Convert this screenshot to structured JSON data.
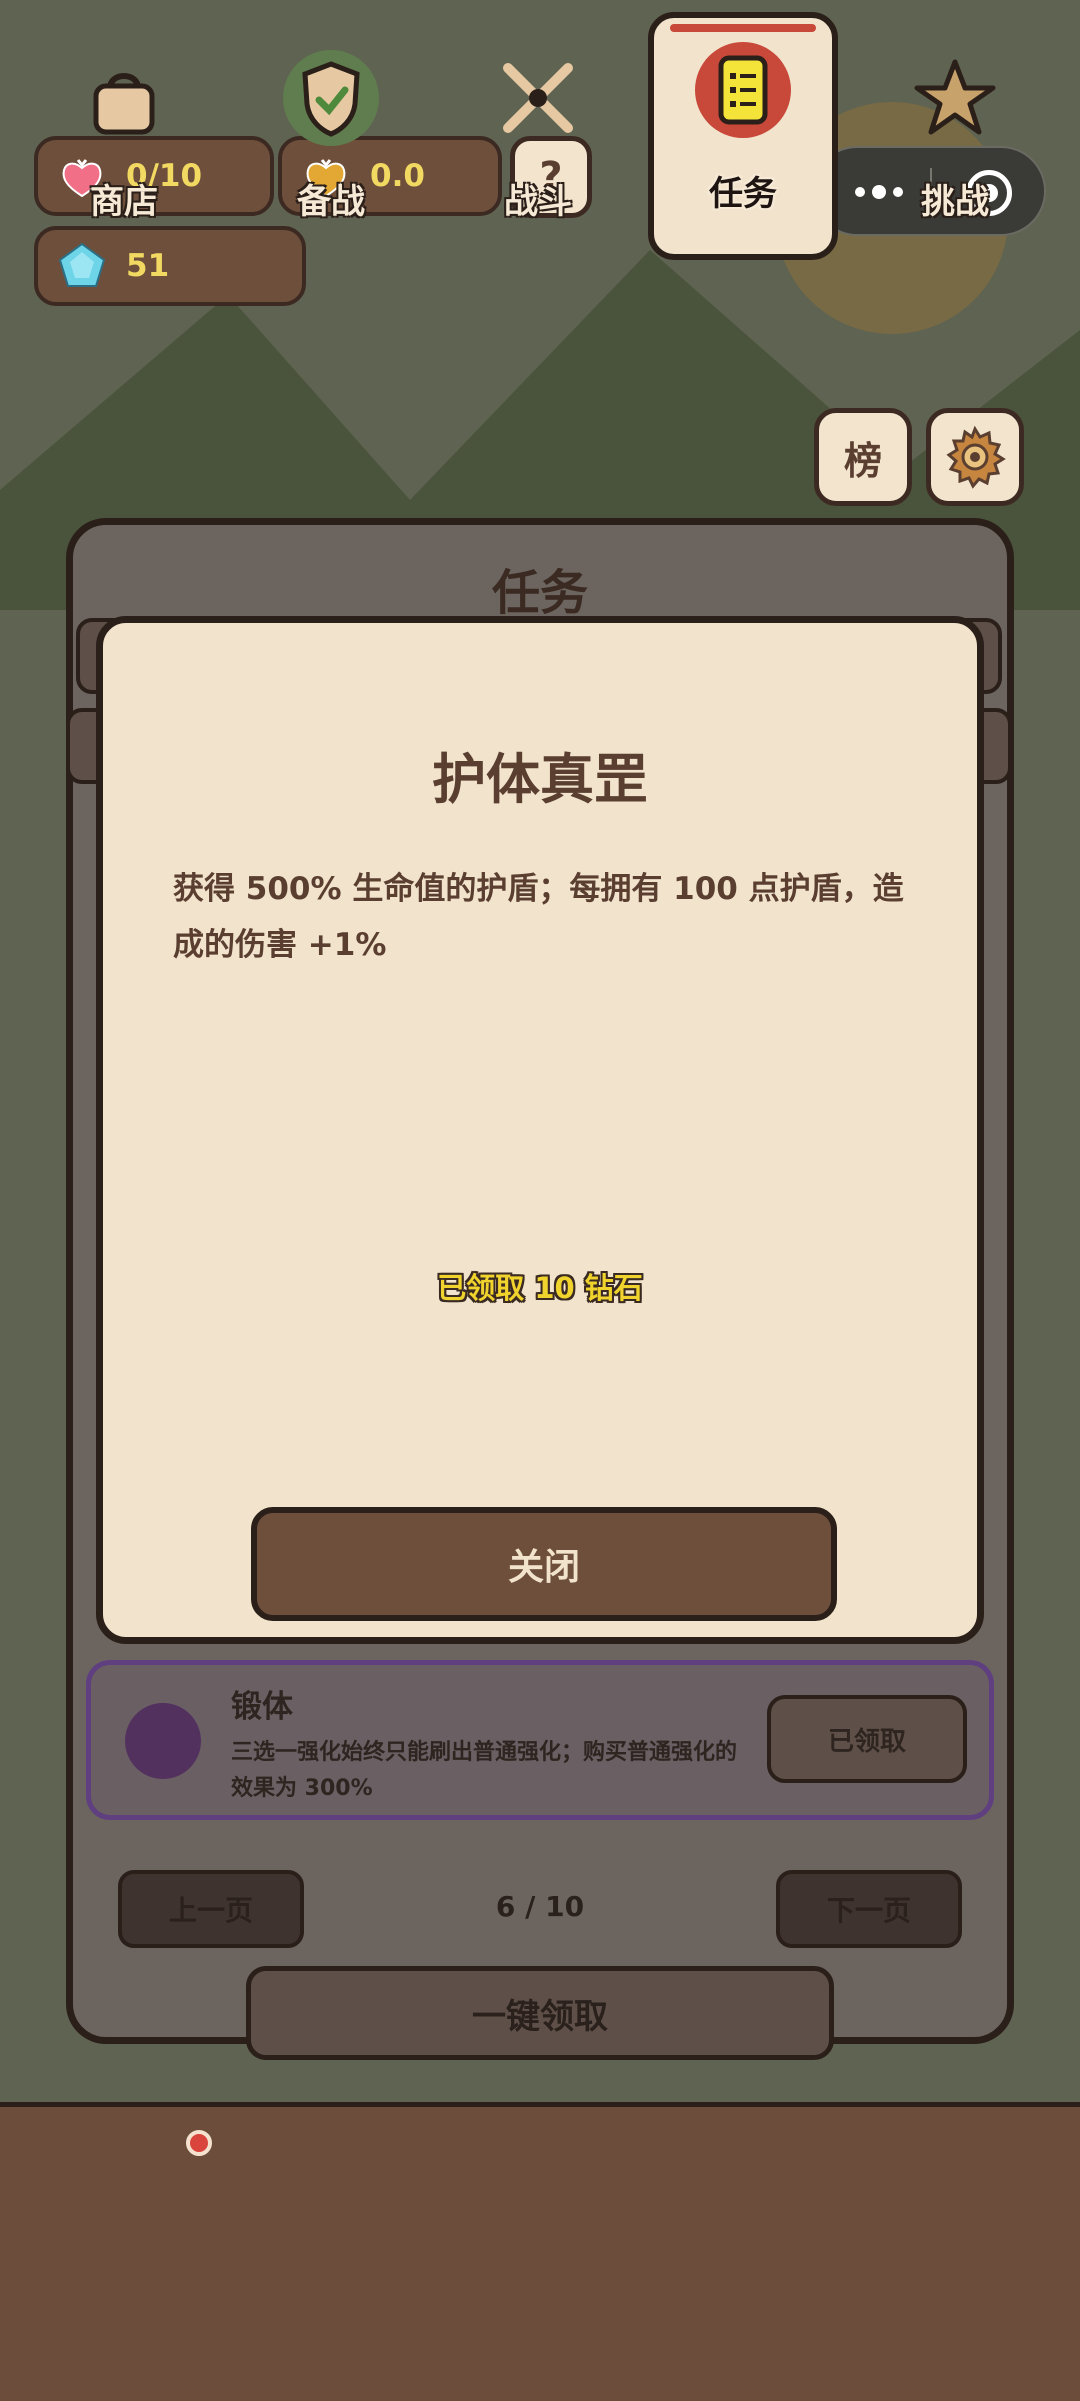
{
  "resources": {
    "hearts": "0/10",
    "gold": "0.0",
    "gems": "51",
    "help_label": "?"
  },
  "top_buttons": {
    "leaderboard_label": "榜"
  },
  "task_panel": {
    "title": "任务",
    "visible_task": {
      "name": "锻体",
      "description": "三选一强化始终只能刷出普通强化；购买普通强化的效果为 300%",
      "status": "已领取"
    },
    "prev_label": "上一页",
    "page": "6 / 10",
    "next_label": "下一页",
    "claim_all_label": "一键领取"
  },
  "modal": {
    "title": "护体真罡",
    "description": "获得 500% 生命值的护盾；每拥有 100 点护盾，造成的伤害 +1%",
    "reward_text": "已领取 10 钻石",
    "close_label": "关闭"
  },
  "tabbar": {
    "items": [
      {
        "label": "商店",
        "icon": "bag-icon"
      },
      {
        "label": "备战",
        "icon": "shield-check-icon"
      },
      {
        "label": "战斗",
        "icon": "crossed-swords-icon"
      },
      {
        "label": "任务",
        "icon": "task-list-icon",
        "active": true
      },
      {
        "label": "挑战",
        "icon": "star-icon"
      }
    ]
  },
  "colors": {
    "sky": "#5f6351",
    "mountain": "#4a533b",
    "panel_brown": "#6e4f3b",
    "cream": "#f1e3cc",
    "gold_text": "#f2da62",
    "task_border": "#5f3f80",
    "badge_red": "#d9443c"
  }
}
